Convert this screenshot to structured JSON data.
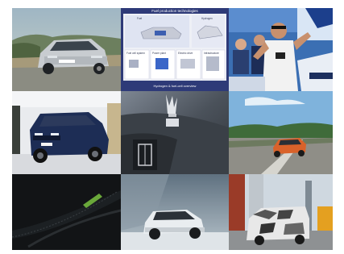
{
  "grid": {
    "tiles": [
      {
        "name": "silver-suv-road"
      },
      {
        "name": "fuel-cell-diagram",
        "title": "Fuel production technologies",
        "caption": "Hydrogen & fuel-cell overview",
        "labels": [
          "Fuel",
          "Hydrogen",
          "Fuel cell system",
          "Power plant",
          "Electric drive",
          "Infrastructure"
        ]
      },
      {
        "name": "celebration-crowd"
      },
      {
        "name": "blue-suv-showroom"
      },
      {
        "name": "hood-ornament-closeup"
      },
      {
        "name": "orange-coupe-coast"
      },
      {
        "name": "dark-fabric-detail"
      },
      {
        "name": "white-electric-suv-studio"
      },
      {
        "name": "camouflaged-van-test"
      }
    ]
  }
}
